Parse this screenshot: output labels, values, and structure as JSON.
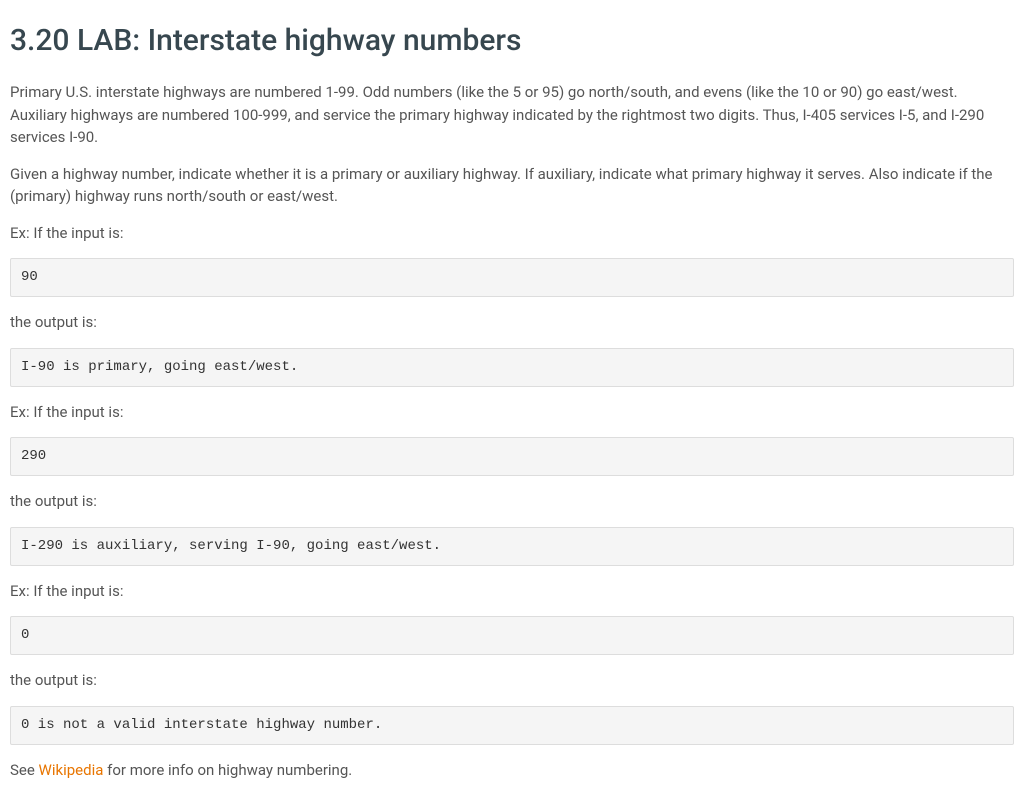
{
  "title": "3.20 LAB: Interstate highway numbers",
  "para1": "Primary U.S. interstate highways are numbered 1-99. Odd numbers (like the 5 or 95) go north/south, and evens (like the 10 or 90) go east/west. Auxiliary highways are numbered 100-999, and service the primary highway indicated by the rightmost two digits. Thus, I-405 services I-5, and I-290 services I-90.",
  "para2": "Given a highway number, indicate whether it is a primary or auxiliary highway. If auxiliary, indicate what primary highway it serves. Also indicate if the (primary) highway runs north/south or east/west.",
  "ex1_prompt": "Ex: If the input is:",
  "ex1_input": "90",
  "ex1_output_label": "the output is:",
  "ex1_output": "I-90 is primary, going east/west.",
  "ex2_prompt": "Ex: If the input is:",
  "ex2_input": "290",
  "ex2_output_label": "the output is:",
  "ex2_output": "I-290 is auxiliary, serving I-90, going east/west.",
  "ex3_prompt": "Ex: If the input is:",
  "ex3_input": "0",
  "ex3_output_label": "the output is:",
  "ex3_output": "0 is not a valid interstate highway number.",
  "footer_pre": "See ",
  "footer_link": "Wikipedia",
  "footer_post": " for more info on highway numbering."
}
